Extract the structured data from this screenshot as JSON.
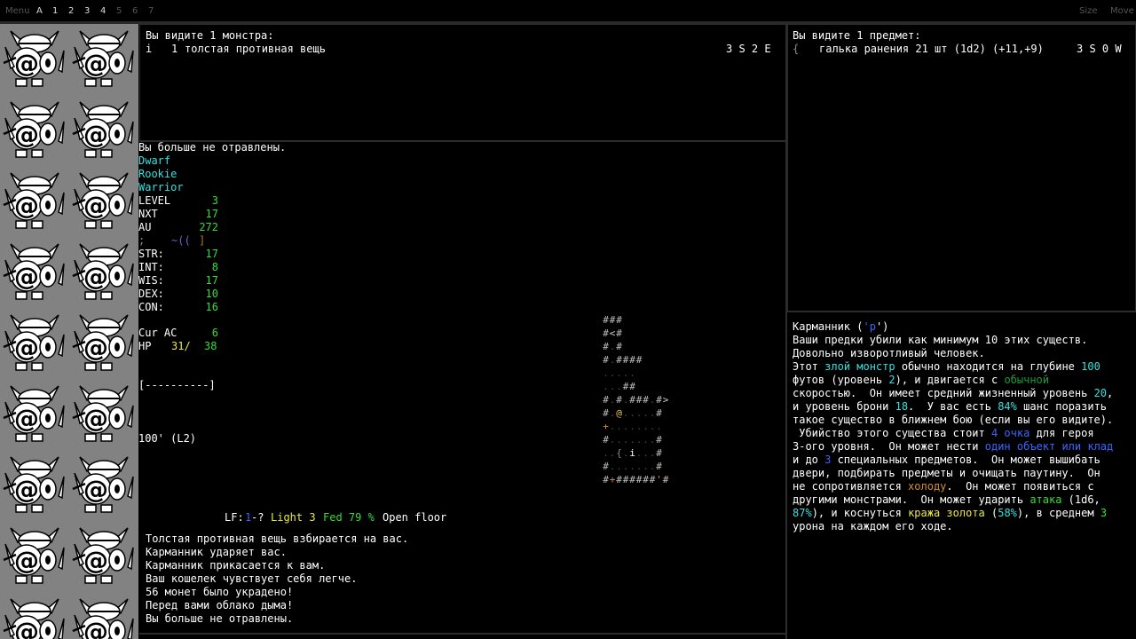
{
  "menubar": {
    "menu": "Menu",
    "tabs": [
      "A",
      "1",
      "2",
      "3",
      "4",
      "5",
      "6",
      "7"
    ],
    "active_tabs": [
      0,
      1,
      2,
      3,
      4
    ],
    "size": "Size",
    "move": "Move"
  },
  "monster_list": {
    "header": "Вы видите 1 монстра:",
    "rows": [
      {
        "glyph": "i",
        "count": "1",
        "name": "толстая противная вещь",
        "dir": "3 S 2 E"
      }
    ]
  },
  "item_list": {
    "header": "Вы видите 1 предмет:",
    "rows": [
      {
        "glyph": "{",
        "name": "галька ранения 21 шт (1d2) (+11,+9)",
        "dir": "3 S 0 W"
      }
    ]
  },
  "sidebar": {
    "msg": "Вы больше не отравлены.",
    "race": "Dwarf",
    "title": "Rookie",
    "class": "Warrior",
    "stats": [
      {
        "label": "LEVEL",
        "value": "3"
      },
      {
        "label": "NXT",
        "value": "17"
      },
      {
        "label": "AU",
        "value": "272"
      }
    ],
    "equip_row": {
      "a": ";",
      "b": "~((",
      "c": "]"
    },
    "attrs": [
      {
        "label": "STR:",
        "value": "17"
      },
      {
        "label": "INT:",
        "value": "8"
      },
      {
        "label": "WIS:",
        "value": "17"
      },
      {
        "label": "DEX:",
        "value": "10"
      },
      {
        "label": "CON:",
        "value": "16"
      }
    ],
    "ac_label": "Cur AC",
    "ac_value": "6",
    "hp_label": "HP",
    "hp_cur": "31/",
    "hp_max": "38",
    "bar": "[----------]",
    "depth": "100' (L2)"
  },
  "statusbar": {
    "lf": "LF:",
    "lf_val": "1",
    "lf_rest": "-?",
    "light": "Light 3",
    "fed": "Fed 79 %",
    "terrain": "Open floor"
  },
  "messages": [
    "Толстая противная вещь взбирается на вас.",
    "Карманник ударяет вас.",
    "Карманник прикасается к вам.",
    "Ваш кошелек чувствует себя легче.",
    "56 монет было украдено!",
    "Перед вами облако дыма!",
    "Вы больше не отравлены."
  ],
  "map_rows": [
    "###",
    "#<#",
    "#.#",
    "#.####",
    ".....",
    "...##",
    "#.#.###.#>",
    "#.@.....#",
    "+........",
    "#.......#",
    "..{.i...#",
    "#.......#",
    "#+######'#"
  ],
  "recall": {
    "title_a": "Карманник (",
    "title_glyph": "'p",
    "title_b": "')",
    "lines": [
      [
        {
          "t": "Ваши предки убили как минимум 10 этих существ."
        }
      ],
      [
        {
          "t": "Довольно изворотливый человек."
        }
      ],
      [
        {
          "t": "Этот "
        },
        {
          "t": "злой монстр",
          "c": "cyan"
        },
        {
          "t": " обычно находится на глубине "
        },
        {
          "t": "100",
          "c": "cyan"
        }
      ],
      [
        {
          "t": "футов (уровень "
        },
        {
          "t": "2",
          "c": "cyan"
        },
        {
          "t": "), и двигается с "
        },
        {
          "t": "обычной",
          "c": "dgreen"
        }
      ],
      [
        {
          "t": "скоростью.  Он имеет средний жизненный уровень "
        },
        {
          "t": "20",
          "c": "cyan"
        },
        {
          "t": ","
        }
      ],
      [
        {
          "t": "и уровень брони "
        },
        {
          "t": "18",
          "c": "cyan"
        },
        {
          "t": ".  У вас есть "
        },
        {
          "t": "84%",
          "c": "cyan"
        },
        {
          "t": " шанс поразить"
        }
      ],
      [
        {
          "t": "такое существо в ближнем бою (если вы его видите)."
        }
      ],
      [
        {
          "t": " Убийство этого существа стоит "
        },
        {
          "t": "4 очка",
          "c": "blue"
        },
        {
          "t": " для героя"
        }
      ],
      [
        {
          "t": "3-ого уровня.  Он может нести "
        },
        {
          "t": "один объект или клад",
          "c": "blue"
        }
      ],
      [
        {
          "t": "и до "
        },
        {
          "t": "3",
          "c": "blue"
        },
        {
          "t": " специальных предметов.  Он может вышибать"
        }
      ],
      [
        {
          "t": "двери, подбирать предметы и очищать паутину.  Он"
        }
      ],
      [
        {
          "t": "не сопротивляется "
        },
        {
          "t": "холоду",
          "c": "orange"
        },
        {
          "t": ".  Он может появиться с"
        }
      ],
      [
        {
          "t": "другими монстрами.  Он может ударить "
        },
        {
          "t": "атака",
          "c": "green"
        },
        {
          "t": " (1d6,"
        }
      ],
      [
        {
          "t": "87%",
          "c": "cyan"
        },
        {
          "t": "), и коснуться "
        },
        {
          "t": "кража золота",
          "c": "yellow"
        },
        {
          "t": " ("
        },
        {
          "t": "58%",
          "c": "cyan"
        },
        {
          "t": "), в среднем "
        },
        {
          "t": "3",
          "c": "green"
        }
      ],
      [
        {
          "t": "урона на каждом его ходе."
        }
      ]
    ]
  },
  "colors": {
    "cyan": "#35e0e0",
    "green": "#34dd34",
    "yellow": "#e8e84a",
    "blue": "#3a66ff",
    "dgreen": "#1f9a3a",
    "orange": "#d58c3a",
    "panel_border": "#2c2c2c",
    "sidebar_bg": "#828282"
  },
  "icons": [
    "player-avatar-tile-icon"
  ]
}
